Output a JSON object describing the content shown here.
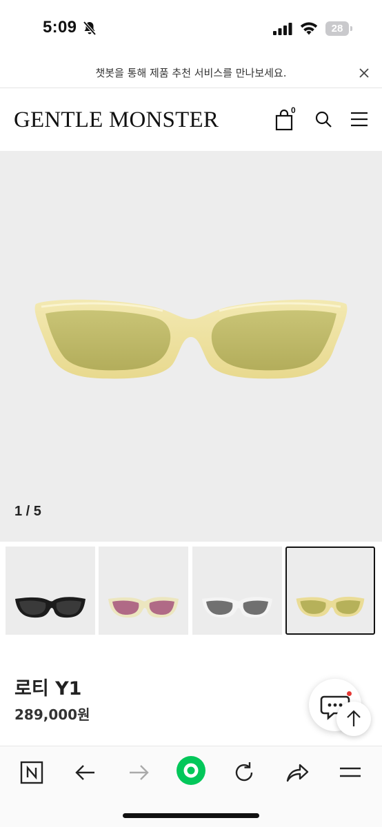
{
  "status_bar": {
    "time": "5:09",
    "battery": "28",
    "icons": [
      "bell-slash-icon",
      "signal-icon",
      "wifi-icon",
      "battery-icon"
    ]
  },
  "notice": {
    "text": "챗봇을 통해 제품 추천 서비스를 만나보세요.",
    "close_icon": "close-icon"
  },
  "header": {
    "logo": "GENTLE MONSTER",
    "cart_count": "0",
    "icons": [
      "shopping-bag-icon",
      "search-icon",
      "hamburger-menu-icon"
    ]
  },
  "gallery": {
    "counter": "1 / 5",
    "thumbnails": [
      {
        "frame": "#1c1c1c",
        "lens": "#3a3a3a"
      },
      {
        "frame": "#ece6bf",
        "lens": "#b06a86"
      },
      {
        "frame": "#f2f2f2",
        "lens": "#707070"
      },
      {
        "frame": "#eadc96",
        "lens": "#b6b15a"
      }
    ],
    "selected_index": 3
  },
  "product": {
    "name": "로티 Y1",
    "price": "289,000원"
  },
  "floating": {
    "icons": [
      "chat-icon",
      "arrow-up-icon"
    ]
  },
  "browser_toolbar": {
    "icons": [
      "naver-n-icon",
      "back-arrow-icon",
      "forward-arrow-icon",
      "green-dot-icon",
      "refresh-icon",
      "share-icon",
      "menu-icon"
    ],
    "accent": "#03c75a"
  }
}
